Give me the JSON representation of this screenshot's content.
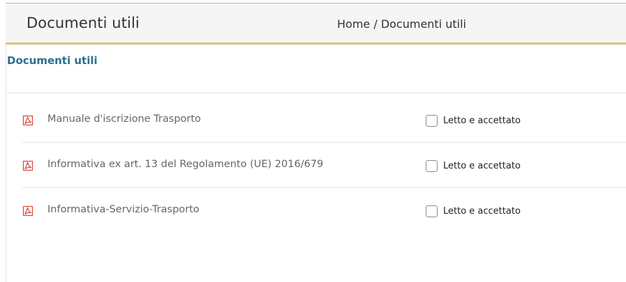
{
  "header": {
    "title": "Documenti utili",
    "breadcrumb": {
      "home": "Home",
      "separator": " / ",
      "current": "Documenti utili"
    }
  },
  "section": {
    "title": "Documenti utili"
  },
  "documents": [
    {
      "name": "Manuale d'iscrizione Trasporto",
      "icon": "pdf-icon",
      "accept_label": "Letto e accettato",
      "checked": false
    },
    {
      "name": "Informativa ex art. 13 del Regolamento (UE) 2016/679",
      "icon": "pdf-icon",
      "accept_label": "Letto e accettato",
      "checked": false
    },
    {
      "name": "Informativa-Servizio-Trasporto",
      "icon": "pdf-icon",
      "accept_label": "Letto e accettato",
      "checked": false
    }
  ],
  "colors": {
    "section_title": "#2b6f8e",
    "header_border": "#d7c480",
    "pdf_icon": "#d9463e"
  }
}
